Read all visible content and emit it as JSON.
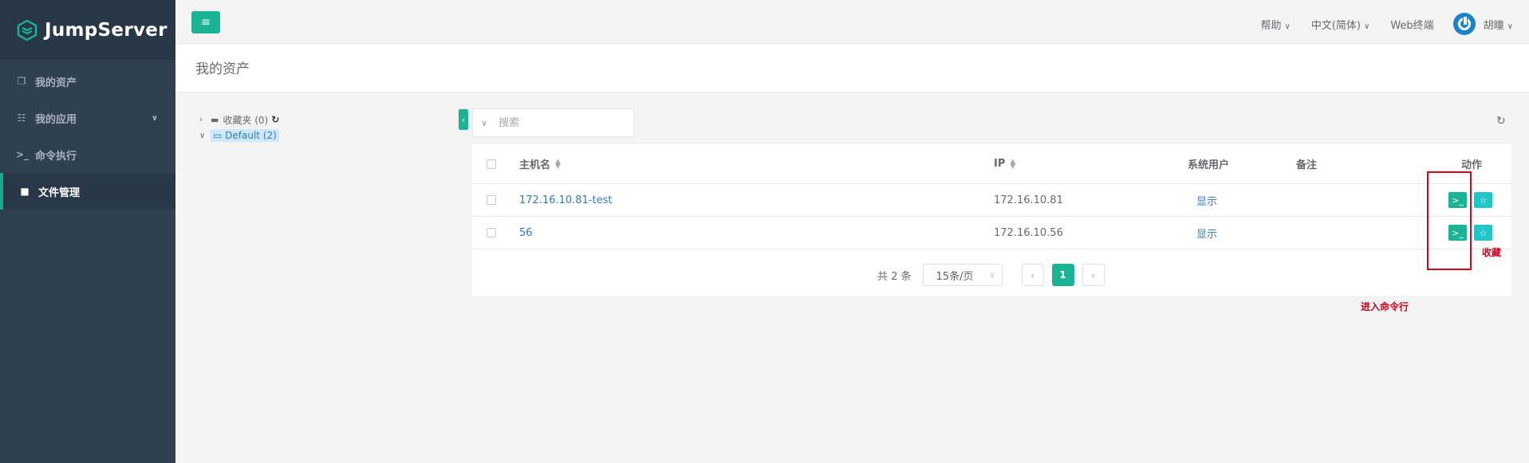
{
  "brand": {
    "name": "JumpServer"
  },
  "sidebar": {
    "items": [
      {
        "label": "我的资产",
        "icon": "cubes-icon"
      },
      {
        "label": "我的应用",
        "icon": "grid-icon"
      },
      {
        "label": "命令执行",
        "icon": "terminal-icon"
      },
      {
        "label": "文件管理",
        "icon": "file-icon"
      }
    ]
  },
  "topbar": {
    "help": "帮助",
    "language": "中文(简体)",
    "web_terminal": "Web终端",
    "user": "胡瞳"
  },
  "page": {
    "title": "我的资产"
  },
  "tree": {
    "favorites": "收藏夹 (0)",
    "default": "Default (2)"
  },
  "search": {
    "placeholder": "搜索"
  },
  "table": {
    "headers": {
      "hostname": "主机名",
      "ip": "IP",
      "system_user": "系统用户",
      "comment": "备注",
      "actions": "动作"
    },
    "rows": [
      {
        "hostname": "172.16.10.81-test",
        "ip": "172.16.10.81",
        "system_user": "显示",
        "comment": ""
      },
      {
        "hostname": "56",
        "ip": "172.16.10.56",
        "system_user": "显示",
        "comment": ""
      }
    ]
  },
  "pagination": {
    "total": "共 2 条",
    "page_size": "15条/页",
    "current": "1"
  },
  "annotations": {
    "favorite": "收藏",
    "enter_cli": "进入命令行"
  },
  "colors": {
    "accent": "#1ab394",
    "sidebar": "#2f4050",
    "link": "#337ab7",
    "annotation": "#d0021b"
  }
}
